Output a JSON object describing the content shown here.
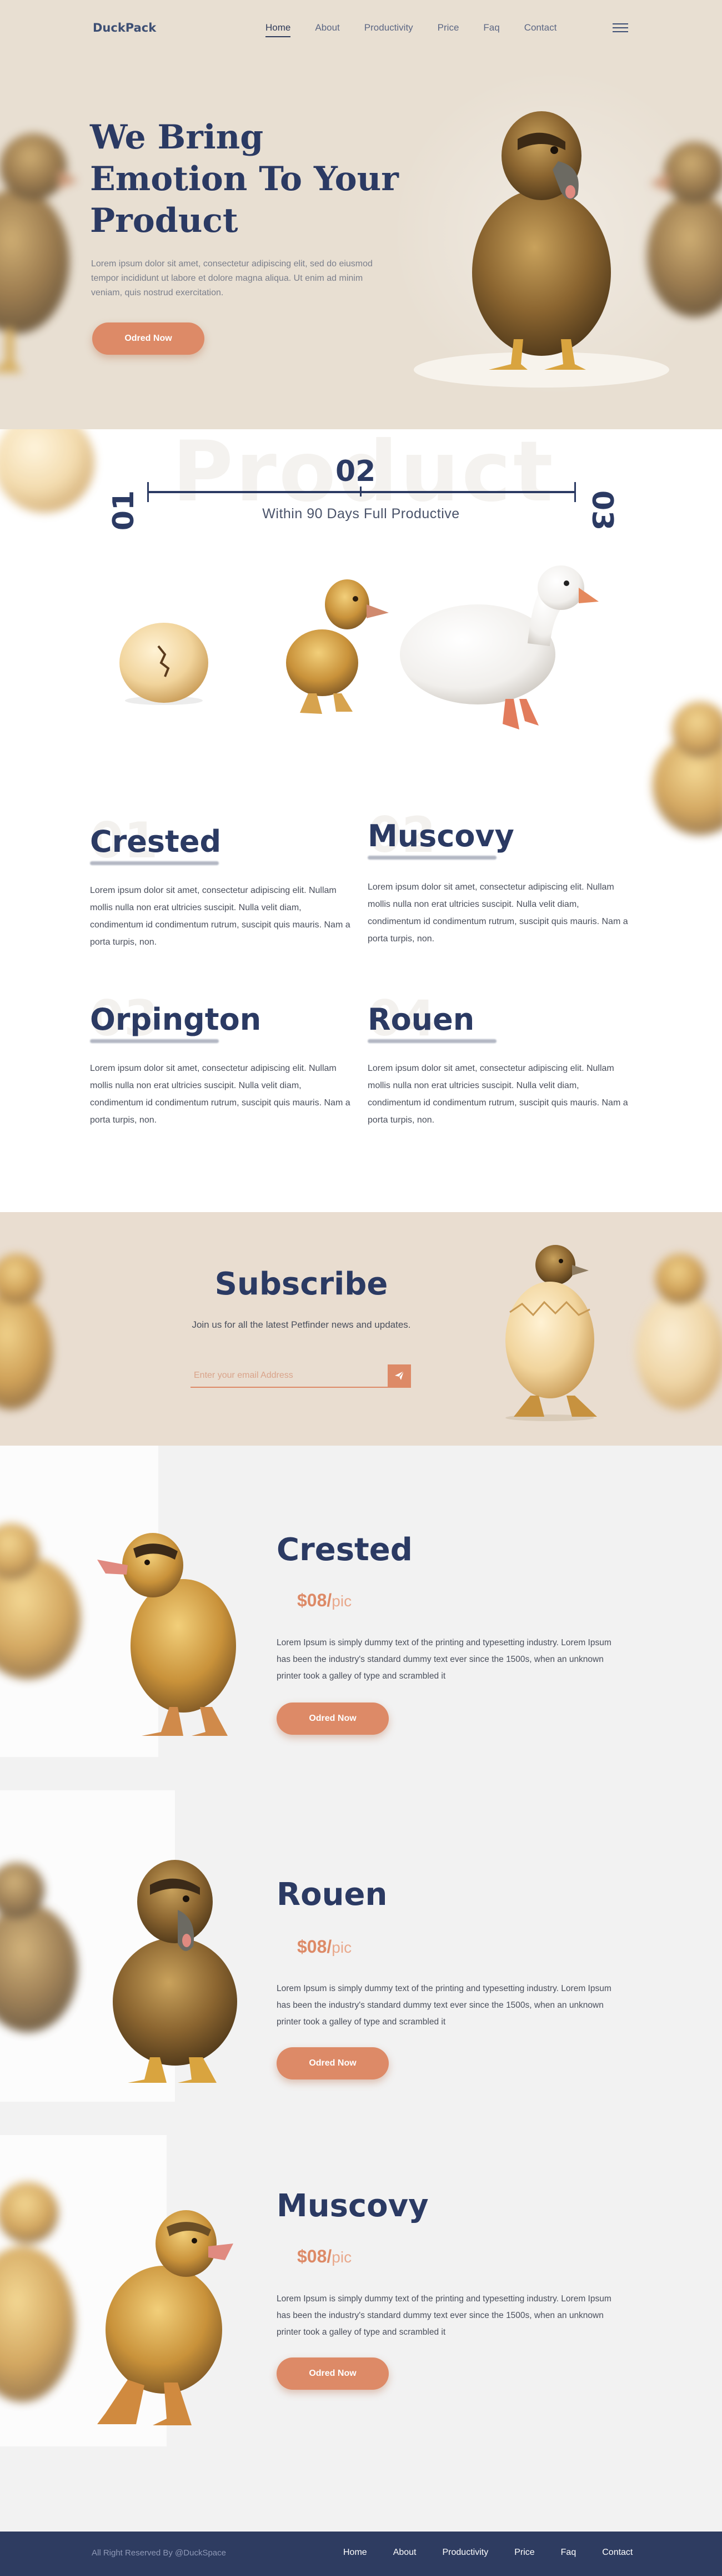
{
  "brand": {
    "logo": "DuckPack",
    "accent": "#dd8a67",
    "navy": "#2b3a63"
  },
  "nav": {
    "items": [
      {
        "label": "Home",
        "active": true
      },
      {
        "label": "About",
        "active": false
      },
      {
        "label": "Productivity",
        "active": false
      },
      {
        "label": "Price",
        "active": false
      },
      {
        "label": "Faq",
        "active": false
      },
      {
        "label": "Contact",
        "active": false
      }
    ],
    "menu_icon": "hamburger-icon"
  },
  "hero": {
    "title_lines": [
      "We Bring",
      "Emotion To Your",
      "Product"
    ],
    "text": "Lorem ipsum dolor sit amet, consectetur adipiscing elit, sed do eiusmod tempor incididunt ut labore et dolore magna aliqua. Ut enim ad minim veniam, quis nostrud exercitation.",
    "button": "Odred Now"
  },
  "productive": {
    "ghost_word": "Product",
    "steps": [
      "01",
      "02",
      "03"
    ],
    "caption": "Within 90 Days Full Productive",
    "breeds": [
      {
        "num": "01",
        "name": "Crested",
        "text": "Lorem ipsum dolor sit amet, consectetur adipiscing elit. Nullam mollis nulla non erat ultricies suscipit. Nulla velit diam, condimentum id condimentum rutrum, suscipit quis mauris. Nam a porta turpis, non."
      },
      {
        "num": "02",
        "name": "Muscovy",
        "text": "Lorem ipsum dolor sit amet, consectetur adipiscing elit. Nullam mollis nulla non erat ultricies suscipit. Nulla velit diam, condimentum id condimentum rutrum, suscipit quis mauris. Nam a porta turpis, non."
      },
      {
        "num": "03",
        "name": "Orpington",
        "text": "Lorem ipsum dolor sit amet, consectetur adipiscing elit. Nullam mollis nulla non erat ultricies suscipit. Nulla velit diam, condimentum id condimentum rutrum, suscipit quis mauris. Nam a porta turpis, non."
      },
      {
        "num": "04",
        "name": "Rouen",
        "text": "Lorem ipsum dolor sit amet, consectetur adipiscing elit. Nullam mollis nulla non erat ultricies suscipit. Nulla velit diam, condimentum id condimentum rutrum, suscipit quis mauris. Nam a porta turpis, non."
      }
    ]
  },
  "subscribe": {
    "title": "Subscribe",
    "text": "Join us for all the latest Petfinder news and updates.",
    "placeholder": "Enter your email Address",
    "send_icon": "paper-plane-icon"
  },
  "products": [
    {
      "name": "Crested",
      "price": "$08/",
      "unit": "pic",
      "text": "Lorem Ipsum is simply dummy text of the printing and typesetting industry. Lorem Ipsum has been the industry's standard dummy text ever since the 1500s, when an unknown printer took a galley of type and scrambled it",
      "button": "Odred Now"
    },
    {
      "name": "Rouen",
      "price": "$08/",
      "unit": "pic",
      "text": "Lorem Ipsum is simply dummy text of the printing and typesetting industry. Lorem Ipsum has been the industry's standard dummy text ever since the 1500s, when an unknown printer took a galley of type and scrambled it",
      "button": "Odred Now"
    },
    {
      "name": "Muscovy",
      "price": "$08/",
      "unit": "pic",
      "text": "Lorem Ipsum is simply dummy text of the printing and typesetting industry. Lorem Ipsum has been the industry's standard dummy text ever since the 1500s, when an unknown printer took a galley of type and scrambled it",
      "button": "Odred Now"
    }
  ],
  "footer": {
    "copyright": "All Right Reserved By @DuckSpace",
    "links": [
      "Home",
      "About",
      "Productivity",
      "Price",
      "Faq",
      "Contact"
    ]
  }
}
